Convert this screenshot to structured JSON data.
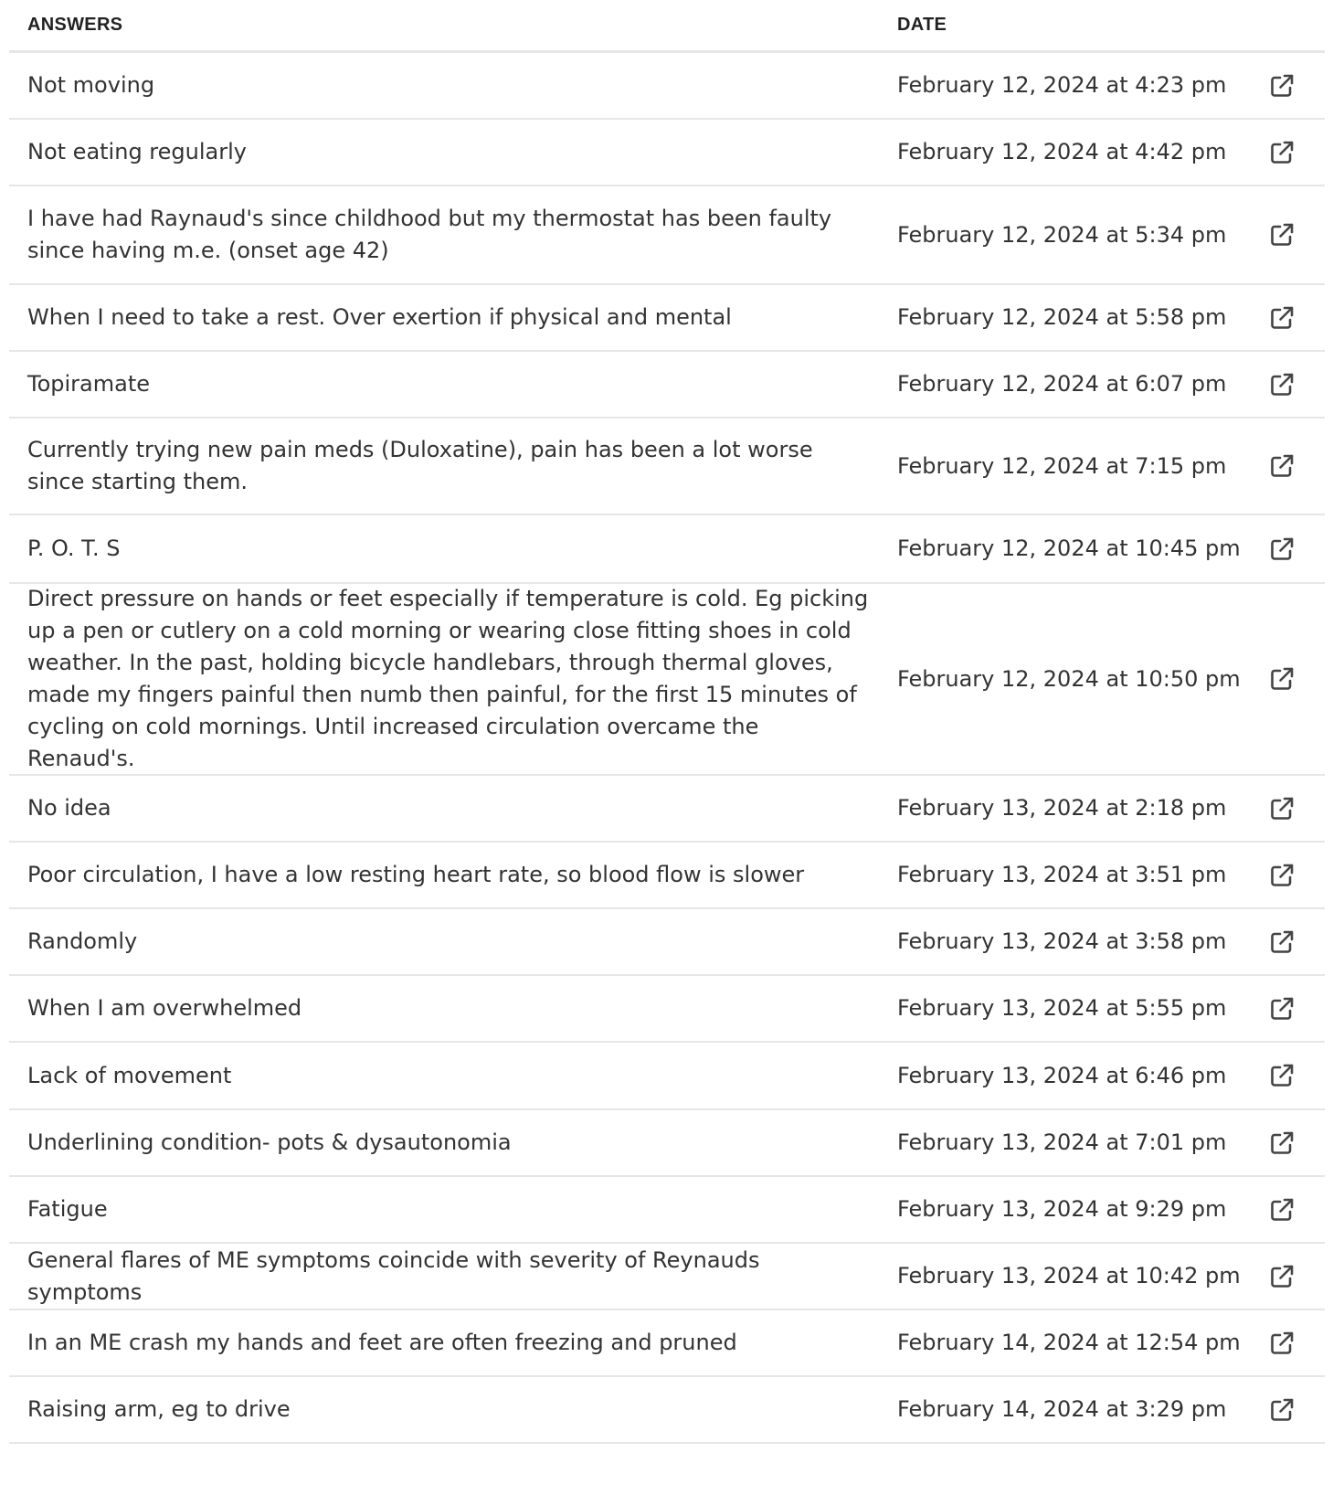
{
  "table": {
    "headers": {
      "answers": "ANSWERS",
      "date": "DATE"
    },
    "rows": [
      {
        "answer": "Not moving",
        "date": "February 12, 2024 at 4:23 pm",
        "icon": "external-link-icon"
      },
      {
        "answer": "Not eating regularly",
        "date": "February 12, 2024 at 4:42 pm",
        "icon": "external-link-icon"
      },
      {
        "answer": "I have had Raynaud's since childhood but my thermostat has been faulty since having m.e. (onset age 42)",
        "date": "February 12, 2024 at 5:34 pm",
        "icon": "external-link-icon"
      },
      {
        "answer": "When I need to take a rest. Over exertion if physical and mental",
        "date": "February 12, 2024 at 5:58 pm",
        "icon": "external-link-icon"
      },
      {
        "answer": "Topiramate",
        "date": "February 12, 2024 at 6:07 pm",
        "icon": "external-link-icon"
      },
      {
        "answer": "Currently trying new pain meds (Duloxatine), pain has been a lot worse since starting them.",
        "date": "February 12, 2024 at 7:15 pm",
        "icon": "external-link-icon"
      },
      {
        "answer": "P. O. T. S",
        "date": "February 12, 2024 at 10:45 pm",
        "icon": "external-link-icon"
      },
      {
        "answer": "Direct pressure on hands or feet especially if temperature is cold. Eg picking up a pen or cutlery on a cold morning or wearing close fitting shoes in cold weather. In the past, holding bicycle handlebars, through thermal gloves, made my fingers painful then numb then painful, for the first 15 minutes of cycling on cold mornings. Until increased circulation overcame the Renaud's.",
        "date": "February 12, 2024 at 10:50 pm",
        "icon": "external-link-icon"
      },
      {
        "answer": "No idea",
        "date": "February 13, 2024 at 2:18 pm",
        "icon": "external-link-icon"
      },
      {
        "answer": "Poor circulation, I have a low resting heart rate, so blood flow is slower",
        "date": "February 13, 2024 at 3:51 pm",
        "icon": "external-link-icon"
      },
      {
        "answer": "Randomly",
        "date": "February 13, 2024 at 3:58 pm",
        "icon": "external-link-icon"
      },
      {
        "answer": "When I am overwhelmed",
        "date": "February 13, 2024 at 5:55 pm",
        "icon": "external-link-icon"
      },
      {
        "answer": "Lack of movement",
        "date": "February 13, 2024 at 6:46 pm",
        "icon": "external-link-icon"
      },
      {
        "answer": "Underlining condition- pots & dysautonomia",
        "date": "February 13, 2024 at 7:01 pm",
        "icon": "external-link-icon"
      },
      {
        "answer": "Fatigue",
        "date": "February 13, 2024 at 9:29 pm",
        "icon": "external-link-icon"
      },
      {
        "answer": "General flares of ME symptoms coincide with severity of Reynauds symptoms",
        "date": "February 13, 2024 at 10:42 pm",
        "icon": "external-link-icon"
      },
      {
        "answer": "In an ME crash my hands and feet are often freezing and pruned",
        "date": "February 14, 2024 at 12:54 pm",
        "icon": "external-link-icon"
      },
      {
        "answer": "Raising arm, eg to drive",
        "date": "February 14, 2024 at 3:29 pm",
        "icon": "external-link-icon"
      }
    ]
  },
  "colors": {
    "text": "#333333",
    "header_text": "#222222",
    "divider": "#e6e6e6",
    "icon": "#444444",
    "background": "#ffffff"
  }
}
